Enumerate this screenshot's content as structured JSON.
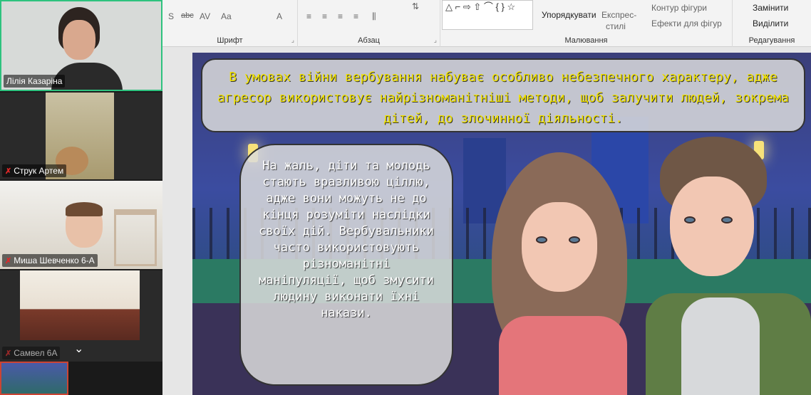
{
  "participants": [
    {
      "name": "Лілія Казаріна",
      "muted": false,
      "active": true
    },
    {
      "name": "Струк Артем",
      "muted": true,
      "active": false
    },
    {
      "name": "Миша Шевченко 6-А",
      "muted": true,
      "active": false
    },
    {
      "name": "Самвел 6А",
      "muted": true,
      "active": false
    }
  ],
  "ribbon": {
    "font_group": "Шрифт",
    "paragraph_group": "Абзац",
    "drawing_group": "Малювання",
    "editing_group": "Редагування",
    "arrange": "Упорядкувати",
    "quick_styles_1": "Експрес-",
    "quick_styles_2": "стилі",
    "shape_outline": "Контур фігури",
    "shape_effects": "Ефекти для фігур",
    "replace": "Замінити",
    "select": "Виділити",
    "font_s": "S",
    "font_abc": "abc",
    "font_av": "AV",
    "font_aa": "Aa",
    "font_a": "A"
  },
  "slide": {
    "title": "В умовах війни вербування набуває особливо небезпечного характеру, адже агресор використовує найрізноманітніші методи, щоб залучити людей, зокрема дітей, до злочинної діяльності.",
    "body": "На жаль, діти та молодь стають вразливою ціллю, адже вони можуть не до кінця розуміти наслідки своїх дій. Вербувальники часто використовують різноманітні маніпуляції, щоб змусити людину виконати їхні накази."
  },
  "colors": {
    "active_speaker": "#2ec27e",
    "title_text": "#f2e300",
    "muted_icon": "#e02828"
  }
}
